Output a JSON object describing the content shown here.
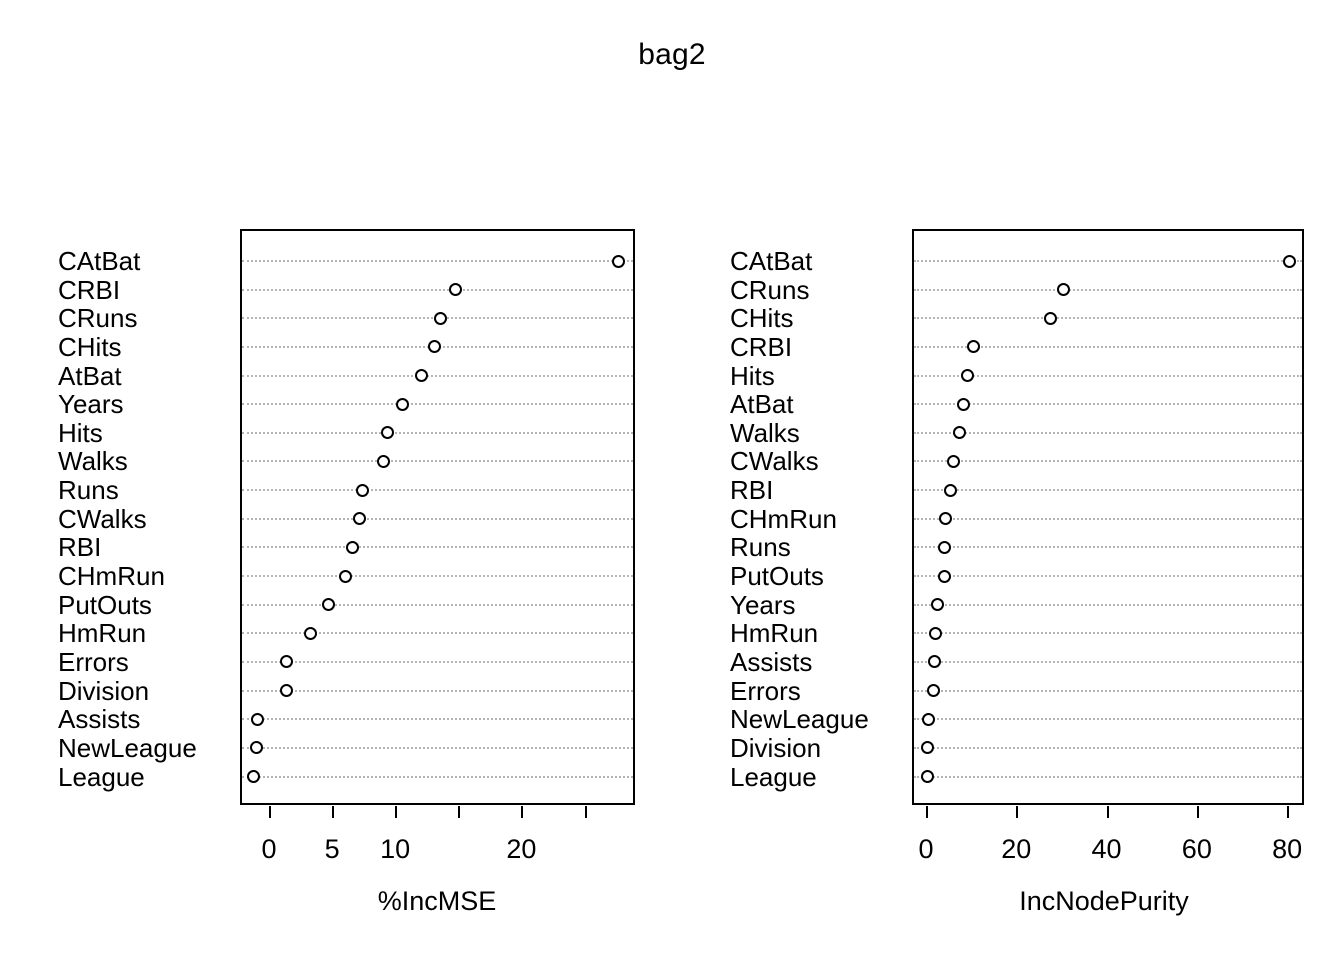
{
  "chart_data": {
    "type": "scatter",
    "title": "bag2",
    "grid": true,
    "legend": null,
    "panels": [
      {
        "name": "percent-inc-mse",
        "xlabel": "%IncMSE",
        "ylabel": "",
        "xlim": [
          -2.0,
          29.5
        ],
        "xticks": [
          0,
          5,
          10,
          15,
          20,
          25
        ],
        "xticklabels": [
          "0",
          "5",
          "10",
          "",
          "20",
          ""
        ],
        "categories": [
          "CAtBat",
          "CRBI",
          "CRuns",
          "CHits",
          "AtBat",
          "Years",
          "Hits",
          "Walks",
          "Runs",
          "CWalks",
          "RBI",
          "CHmRun",
          "PutOuts",
          "HmRun",
          "Errors",
          "Division",
          "Assists",
          "NewLeague",
          "League"
        ],
        "values": [
          27.7,
          14.8,
          13.6,
          13.1,
          12.1,
          10.6,
          9.4,
          9.1,
          7.4,
          7.2,
          6.6,
          6.1,
          4.7,
          3.3,
          1.4,
          1.35,
          -0.9,
          -1.0,
          -1.2
        ]
      },
      {
        "name": "inc-node-purity",
        "xlabel": "IncNodePurity",
        "ylabel": "",
        "xlim": [
          -1.5,
          83.5
        ],
        "xticks": [
          0,
          20,
          40,
          60,
          80
        ],
        "xticklabels": [
          "0",
          "20",
          "40",
          "60",
          "80"
        ],
        "categories": [
          "CAtBat",
          "CRuns",
          "CHits",
          "CRBI",
          "Hits",
          "AtBat",
          "Walks",
          "CWalks",
          "RBI",
          "CHmRun",
          "Runs",
          "PutOuts",
          "Years",
          "HmRun",
          "Assists",
          "Errors",
          "NewLeague",
          "Division",
          "League"
        ],
        "values": [
          80.6,
          30.5,
          27.6,
          10.6,
          9.1,
          8.4,
          7.5,
          6.0,
          5.5,
          4.4,
          4.2,
          4.0,
          2.6,
          2.2,
          1.8,
          1.7,
          0.5,
          0.4,
          0.35
        ]
      }
    ]
  },
  "colors": {
    "background": "#ffffff",
    "foreground": "#000000",
    "gridline": "#b4b4b4"
  }
}
